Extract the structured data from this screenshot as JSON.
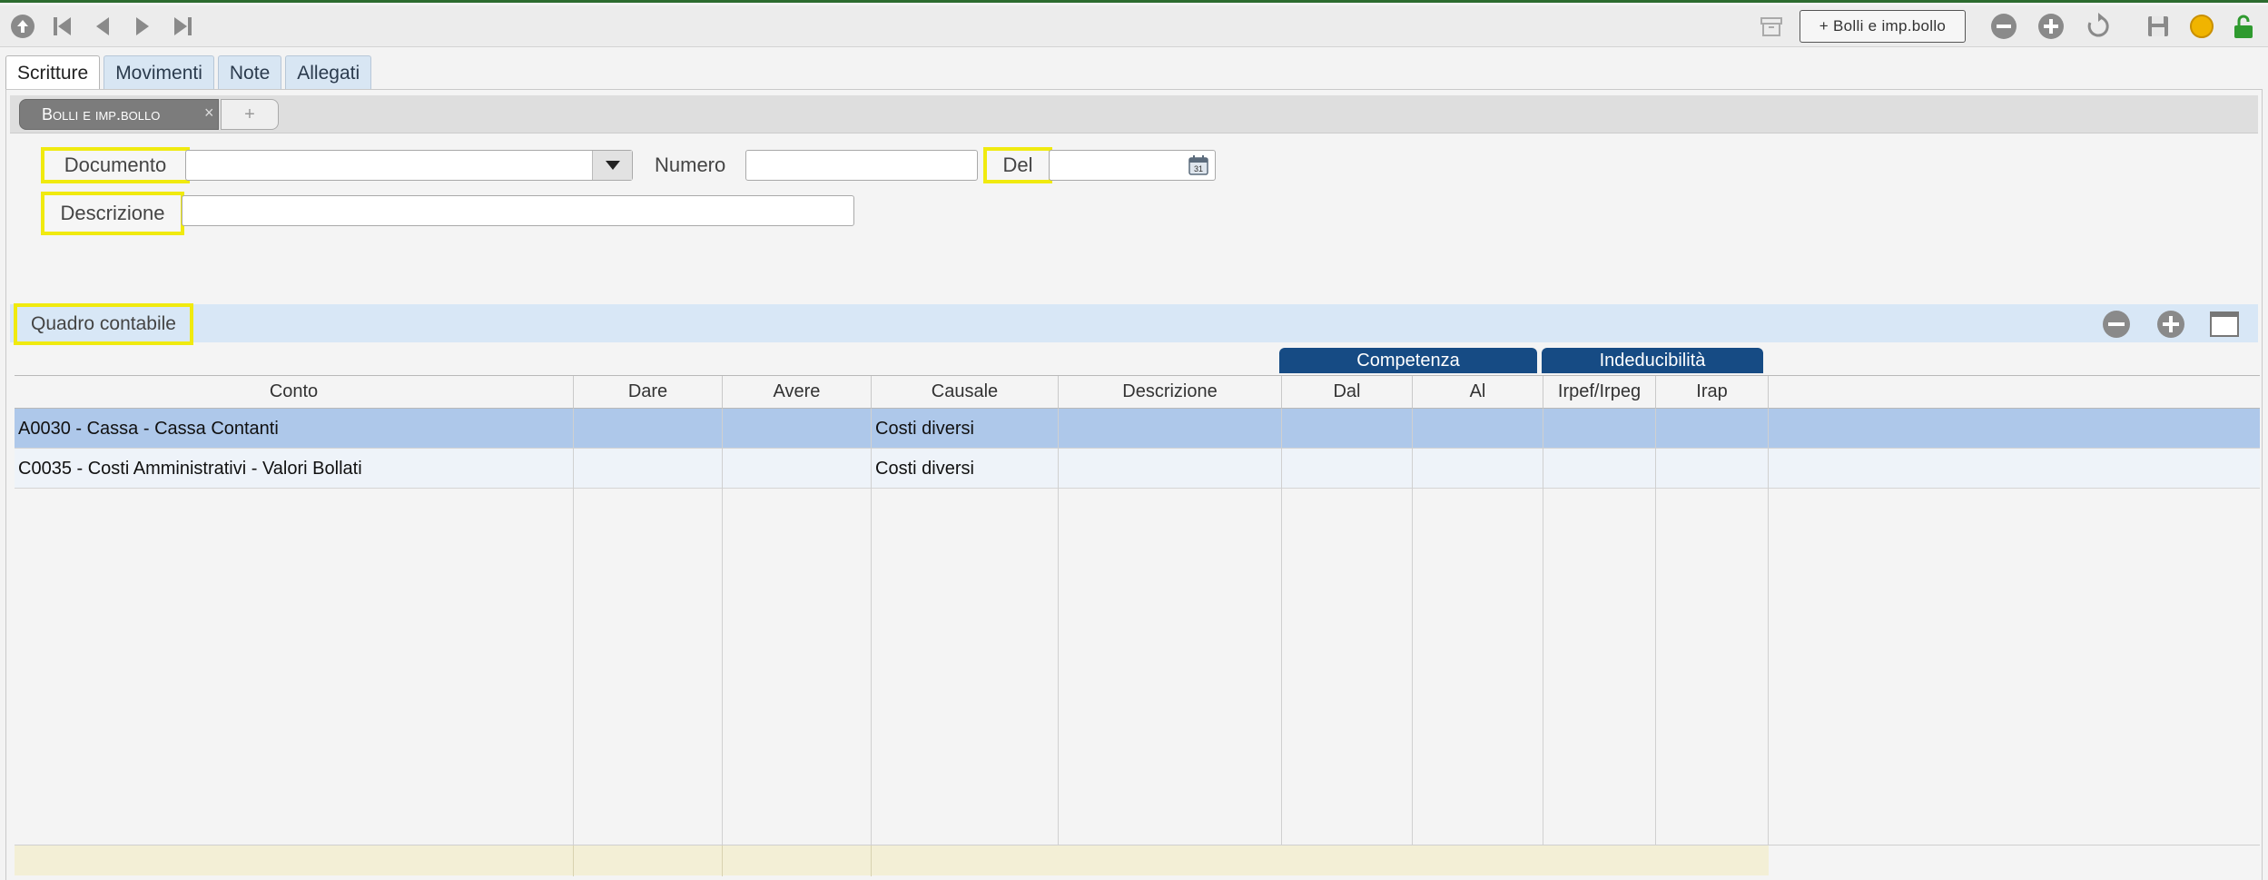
{
  "toolbar": {
    "icons": [
      "upload-circle-icon",
      "first-record-icon",
      "previous-record-icon",
      "next-record-icon",
      "last-record-icon"
    ],
    "right_button_label": "+ Bolli e imp.bollo",
    "right_icons": [
      "archive-icon",
      "remove-circle-icon",
      "add-circle-icon",
      "refresh-icon",
      "save-icon",
      "status-dot-icon",
      "unlock-icon"
    ]
  },
  "tabs": [
    {
      "label": "Scritture",
      "active": true
    },
    {
      "label": "Movimenti",
      "active": false
    },
    {
      "label": "Note",
      "active": false
    },
    {
      "label": "Allegati",
      "active": false
    }
  ],
  "subtab": {
    "label": "Bolli e imp.bollo",
    "close": "×",
    "add": "+"
  },
  "form": {
    "documento_label": "Documento",
    "documento_value": "",
    "numero_label": "Numero",
    "numero_value": "",
    "del_label": "Del",
    "del_value": "",
    "descrizione_label": "Descrizione",
    "descrizione_value": ""
  },
  "quadro": {
    "title": "Quadro contabile",
    "groups": {
      "competenza": "Competenza",
      "indeducibilita": "Indeducibilità"
    },
    "columns": [
      "Conto",
      "Dare",
      "Avere",
      "Causale",
      "Descrizione",
      "Dal",
      "Al",
      "Irpef/Irpeg",
      "Irap"
    ],
    "rows": [
      {
        "conto": "A0030 - Cassa - Cassa Contanti",
        "dare": "",
        "avere": "",
        "causale": "Costi diversi",
        "descrizione": "",
        "dal": "",
        "al": "",
        "irpef": "",
        "irap": "",
        "selected": true
      },
      {
        "conto": "C0035 - Costi Amministrativi - Valori Bollati",
        "dare": "",
        "avere": "",
        "causale": "Costi diversi",
        "descrizione": "",
        "dal": "",
        "al": "",
        "irpef": "",
        "irap": "",
        "selected": false
      }
    ]
  },
  "colors": {
    "selected_row": "#aec8ea",
    "alt_row": "#eef3f9",
    "group_header": "#164b84",
    "highlight": "#f0ea0f",
    "footer": "#f3efd6"
  }
}
